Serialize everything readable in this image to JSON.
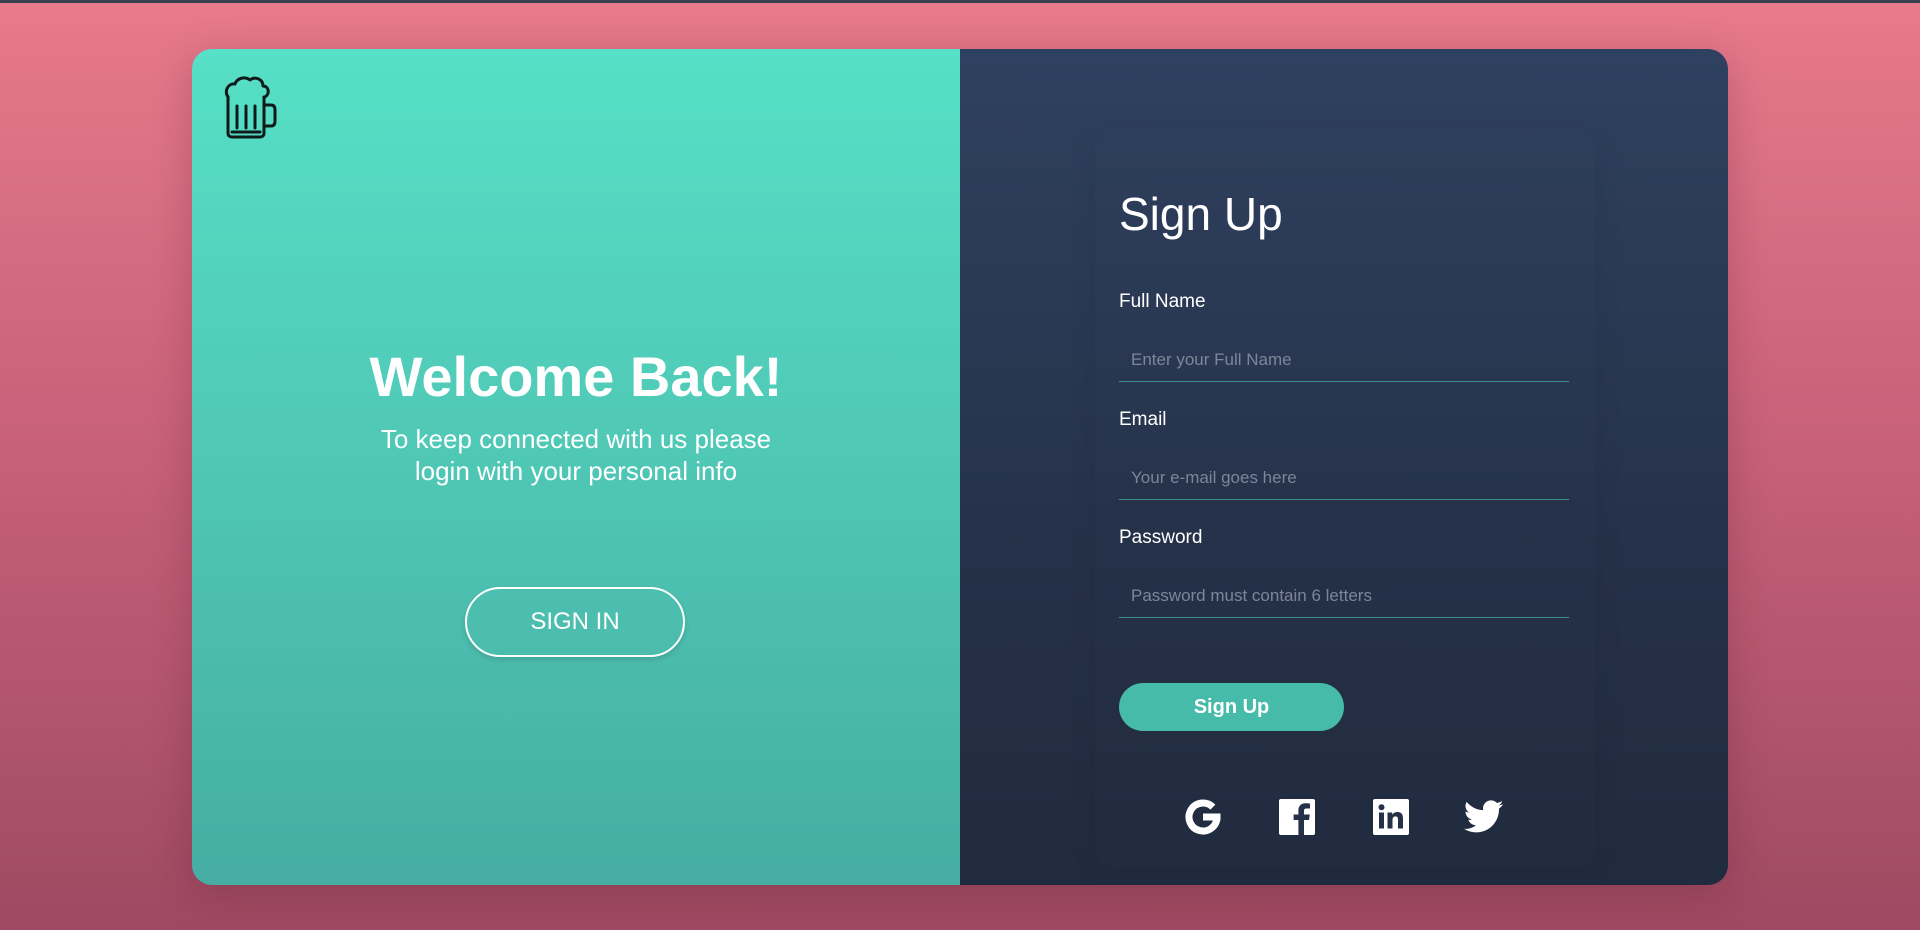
{
  "left": {
    "logo_icon": "beer-mug-icon",
    "title": "Welcome Back!",
    "text": "To keep connected with us please login with your personal info",
    "signin_label": "SIGN IN"
  },
  "form": {
    "title": "Sign Up",
    "fields": [
      {
        "label": "Full Name",
        "placeholder": "Enter your Full Name"
      },
      {
        "label": "Email",
        "placeholder": "Your e-mail goes here"
      },
      {
        "label": "Password",
        "placeholder": "Password must contain 6 letters"
      }
    ],
    "submit_label": "Sign Up"
  },
  "social": [
    "google-icon",
    "facebook-icon",
    "linkedin-icon",
    "twitter-icon"
  ],
  "colors": {
    "background_top": "#e77a8b",
    "background_bottom": "#9e4a62",
    "left_panel": "#4fc7b5",
    "right_panel": "#253148",
    "accent": "#46bba9"
  }
}
